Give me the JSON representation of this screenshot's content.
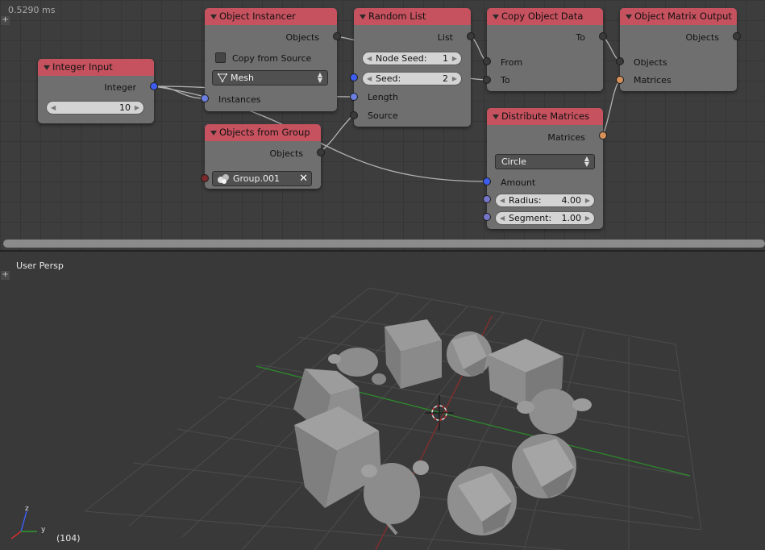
{
  "node_editor": {
    "timing": "0.5290 ms",
    "nodes": {
      "integer_input": {
        "title": "Integer Input",
        "output_label": "Integer",
        "value": "10"
      },
      "object_instancer": {
        "title": "Object Instancer",
        "output_label": "Objects",
        "checkbox_label": "Copy from Source",
        "type_value": "Mesh",
        "input_label": "Instances"
      },
      "objects_from_group": {
        "title": "Objects from Group",
        "output_label": "Objects",
        "group_value": "Group.001"
      },
      "random_list": {
        "title": "Random List",
        "output_label": "List",
        "node_seed_label": "Node Seed:",
        "node_seed_value": "1",
        "seed_label": "Seed:",
        "seed_value": "2",
        "length_label": "Length",
        "source_label": "Source"
      },
      "copy_object_data": {
        "title": "Copy Object Data",
        "output_label": "To",
        "from_label": "From",
        "to_label": "To"
      },
      "distribute_matrices": {
        "title": "Distribute Matrices",
        "output_label": "Matrices",
        "mode_value": "Circle",
        "amount_label": "Amount",
        "radius_label": "Radius:",
        "radius_value": "4.00",
        "segment_label": "Segment:",
        "segment_value": "1.00"
      },
      "object_matrix_output": {
        "title": "Object Matrix Output",
        "output_label": "Objects",
        "objects_label": "Objects",
        "matrices_label": "Matrices"
      }
    }
  },
  "viewport": {
    "view_label": "User Persp",
    "frame_label": "(104)",
    "axis_x": "x",
    "axis_y": "y",
    "axis_z": "z"
  },
  "colors": {
    "node_header": "#c7525f",
    "node_body": "#6f6f6f",
    "socket_blue": "#6a7fe0",
    "socket_orange": "#d6905a",
    "grid_green": "#2d8a2d",
    "grid_red": "#8a2d2d"
  }
}
